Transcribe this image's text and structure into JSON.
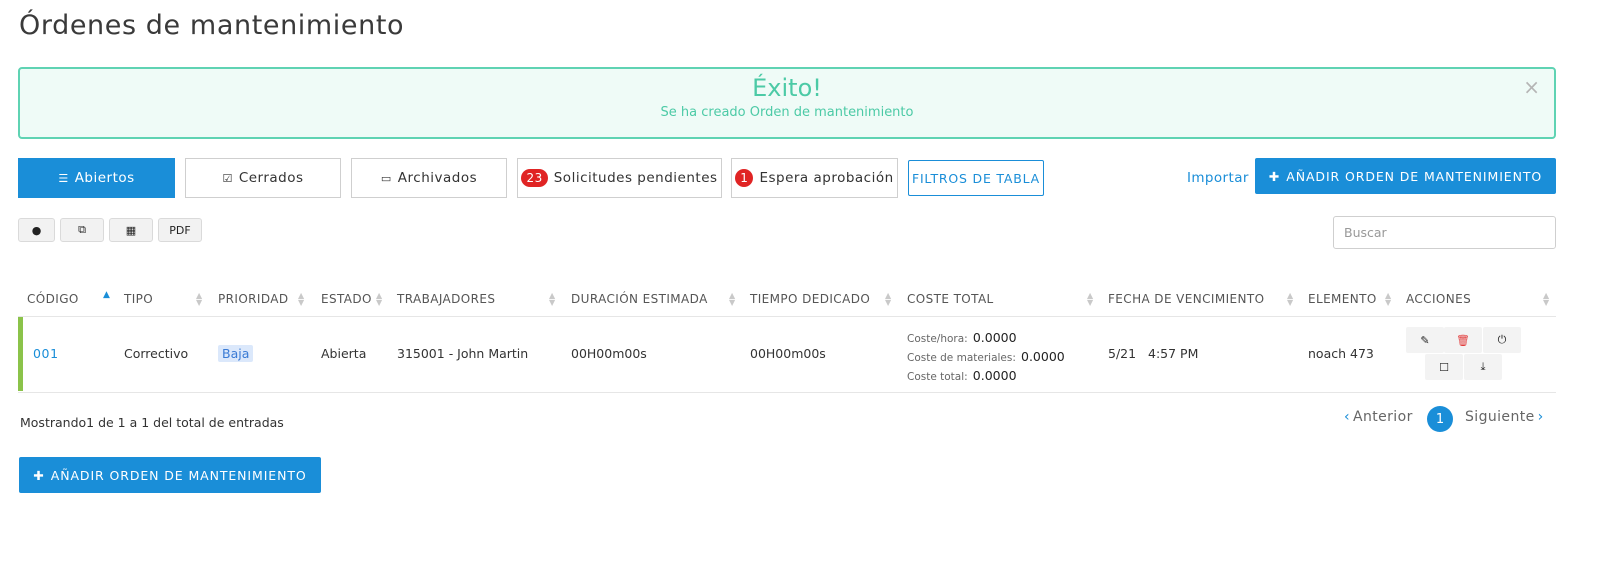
{
  "page": {
    "title": "Órdenes de mantenimiento"
  },
  "alert": {
    "title": "Éxito!",
    "message": "Se ha creado Orden de mantenimiento",
    "close": "×"
  },
  "tabs": [
    {
      "label": "Abiertos",
      "icon": "list-icon",
      "active": true
    },
    {
      "label": "Cerrados",
      "icon": "checkbox-icon",
      "active": false
    },
    {
      "label": "Archivados",
      "icon": "inbox-icon",
      "active": false
    },
    {
      "label": "Solicitudes pendientes",
      "badge": "23",
      "active": false
    },
    {
      "label": "Espera aprobación",
      "badge": "1",
      "active": false
    }
  ],
  "filters_button": "FILTROS DE TABLA",
  "import_link": "Importar",
  "add_button": "AÑADIR ORDEN DE MANTENIMIENTO",
  "toolbar": {
    "view": "eye-icon",
    "copy": "copy-icon",
    "table": "table-icon",
    "pdf": "PDF"
  },
  "search": {
    "placeholder": "Buscar",
    "value": ""
  },
  "table": {
    "columns": [
      "CÓDIGO",
      "TIPO",
      "PRIORIDAD",
      "ESTADO",
      "TRABAJADORES",
      "DURACIÓN ESTIMADA",
      "TIEMPO DEDICADO",
      "COSTE TOTAL",
      "FECHA DE VENCIMIENTO",
      "ELEMENTO",
      "ACCIONES"
    ],
    "sorted_column": "CÓDIGO",
    "sort_direction": "ascending",
    "rows": [
      {
        "code": "001",
        "type": "Correctivo",
        "priority": "Baja",
        "status": "Abierta",
        "workers": "315001 - John Martin",
        "estimated_duration": "00H00m00s",
        "time_spent": "00H00m00s",
        "cost": {
          "hour_label": "Coste/hora:",
          "hour_value": "0.0000",
          "materials_label": "Coste de materiales:",
          "materials_value": "0.0000",
          "total_label": "Coste total:",
          "total_value": "0.0000"
        },
        "due_date": "5/21   4:57 PM",
        "element": "noach 473",
        "status_color": "#8bc34a",
        "actions": [
          "edit-icon",
          "trash-icon",
          "power-icon",
          "archive-icon",
          "download-icon"
        ]
      }
    ]
  },
  "footer": {
    "info": "Mostrando1 de 1 a 1 del total de entradas"
  },
  "pagination": {
    "prev": "Anterior",
    "current": "1",
    "next": "Siguiente"
  },
  "colors": {
    "primary": "#1a8ed8",
    "success": "#4ccaa6",
    "danger": "#e02424",
    "row_status": "#8bc34a"
  }
}
